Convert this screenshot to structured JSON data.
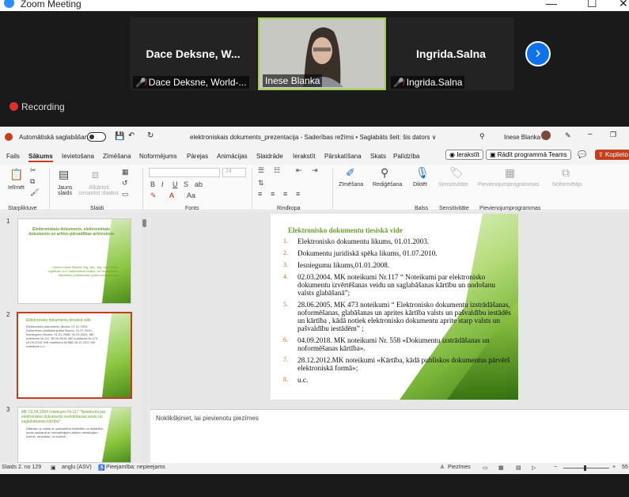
{
  "zoom": {
    "title": "Zoom Meeting",
    "recording_label": "Recording",
    "tiles": [
      {
        "big": "Dace Deksne, W...",
        "name": "Dace Deksne, World-..."
      },
      {
        "big": "",
        "name": "Inese Blanka"
      },
      {
        "big": "Ingrida.Salna",
        "name": "Ingrida.Salna"
      }
    ],
    "next_icon": "chevron-right-icon"
  },
  "ppt": {
    "autosave_label": "Automātiskā saglabāšana",
    "doc_title": "elektroniskais dokuments_prezentacija  -  Saderības režīms  •  Saglabāts šeit: šis dators ∨",
    "user": "Inese Blanka",
    "tabs": [
      "Fails",
      "Sākums",
      "Ievietošana",
      "Zīmēšana",
      "Noformējums",
      "Pārejas",
      "Animācijas",
      "Slaidrāde",
      "Ierakstīt",
      "Pārskatīšana",
      "Skats",
      "Palīdzība"
    ],
    "record_btn": "Ierakstīt",
    "teams_btn": "Rādīt programmā Teams",
    "share_btn": "Koplieto",
    "ribbon": {
      "paste": "Ielīmēt",
      "new_slide": "Jauns slaids",
      "reuse": "Atkārtoti izmantot slaidus",
      "draw": "Zīmēšana",
      "editing": "Rediģēšana",
      "dictate": "Diktēt",
      "sensitivity": "Sensitivitāte",
      "addins": "Pievienojumprogrammas",
      "designer": "Noformētājs",
      "groups": [
        "Starpliktuve",
        "Slaidi",
        "Fonts",
        "Rindkopa",
        "Balss",
        "Sensitivitāte",
        "Pievienojumprogrammas"
      ]
    },
    "thumbnails": [
      {
        "num": "1",
        "title": "Elektroniskais dokuments, elektroniskais dokuments un arhīvu pārvaldības arhīvistiem",
        "sub": "Lektore Inese Blanka, Mg. hist., Mg. oec. Mūža izglītības LLU Sabiedrības zinātņu un Humanitāro fakultātes profesionālo grādu programmas"
      },
      {
        "num": "2",
        "title": "Elektronisko dokumentu tiesiskā vide",
        "sub": "Elektronisko dokumentu likums, 01.01.2003. Dokumentu juridiskā spēka likums, 01.07.2010. Iesniegumu likums, 01.01.2008. 02.03.2004. MK noteikumi Nr.117 28.06.2005. MK noteikumi Nr.473 04.09.2018. MK noteikumi Nr.558 28.12.2012 MK noteikumi u.c."
      },
      {
        "num": "3",
        "title": "MK 03.04.2004 noteikumi Nr.117 \"Noteikumi par elektronisko dokumentu izvērtēšanas veidu un saglabāšanas kārtību\"",
        "sub": "Attiecas uz valsts un pašvaldību iestādēm un iestādēm, kuras saskaņā ar normatīvajiem aktiem institūcijām... Arhīvā, arhivāras, un izvērtē..."
      }
    ],
    "slide": {
      "title": "Elektronisko dokumentu tiesiskā vide",
      "items": [
        {
          "n": "1.",
          "text": "Elektronisko dokumentu likums, 01.01.2003."
        },
        {
          "n": "2.",
          "text": "Dokumentu juridiskā spēka likums, 01.07.2010."
        },
        {
          "n": "3.",
          "text": "Iesniegumu likums,01.01.2008."
        },
        {
          "n": "4.",
          "text": "02.03.2004. MK noteikumi Nr.117 “ Noteikumi par elektronisko dokumentu izvērtēšanas veidu un saglabāšanas kārtību un nodošanu valsts glabāšanā”;"
        },
        {
          "n": "5.",
          "text": "28.06.2005. MK 473 noteikumi “ Elektronisko dokumentu izstrādāšanas, noformēšanas, glabāšanas un aprites kārtība valsts un pašvaldību iestādēs un kārtība , kādā notiek elektronisko dokumentu aprite starp valsts un pašvaldību iestādēm” ;"
        },
        {
          "n": "6.",
          "text": "04.09.2018. MK noteikumi Nr. 558 «Dokumentu izstrādāšanas un noformēšanas kārtība»."
        },
        {
          "n": "7.",
          "text": "28.12.2012.MK noteikumi «Kārtība, kādā publiskos dokumentus pārvērš elektroniskā formā»;"
        },
        {
          "n": "8.",
          "text": "u.c."
        }
      ]
    },
    "notes_placeholder": "Noklikšķiniet, lai pievienotu piezīmes",
    "status": {
      "slide": "Slaids 2. no 129",
      "lang": "angļu (ASV)",
      "access": "Pieejamība: nepieejams",
      "notes": "Piezīmes",
      "zoom": "55"
    }
  }
}
